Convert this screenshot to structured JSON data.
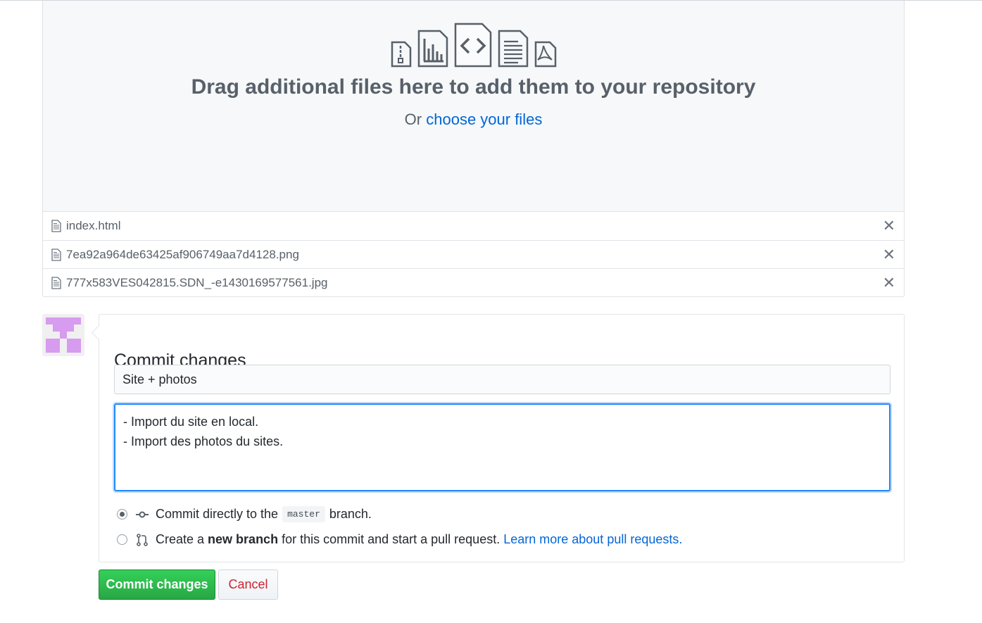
{
  "dropzone": {
    "title": "Drag additional files here to add them to your repository",
    "or_text": "Or",
    "choose_link": "choose your files",
    "icons": [
      "zip-file-icon",
      "graph-file-icon",
      "code-file-icon",
      "text-file-icon",
      "pdf-file-icon"
    ]
  },
  "files": [
    {
      "name": "index.html"
    },
    {
      "name": "7ea92a964de63425af906749aa7d4128.png"
    },
    {
      "name": "777x583VES042815.SDN_-e1430169577561.jpg"
    }
  ],
  "remove_glyph": "✕",
  "commit": {
    "heading": "Commit changes",
    "summary_value": "Site + photos",
    "description_value": "- Import du site en local.\n- Import des photos du sites.",
    "option_direct_pre": "Commit directly to the",
    "branch_name": "master",
    "option_direct_post": "branch.",
    "option_new_pre": "Create a",
    "option_new_bold": "new branch",
    "option_new_post": "for this commit and start a pull request.",
    "learn_more": "Learn more about pull requests.",
    "selected_option": "direct"
  },
  "buttons": {
    "commit": "Commit changes",
    "cancel": "Cancel"
  },
  "colors": {
    "accent_link": "#0366d6",
    "primary_button": "#28a745",
    "cancel_text": "#cb2431",
    "avatar": "#d79bef"
  }
}
